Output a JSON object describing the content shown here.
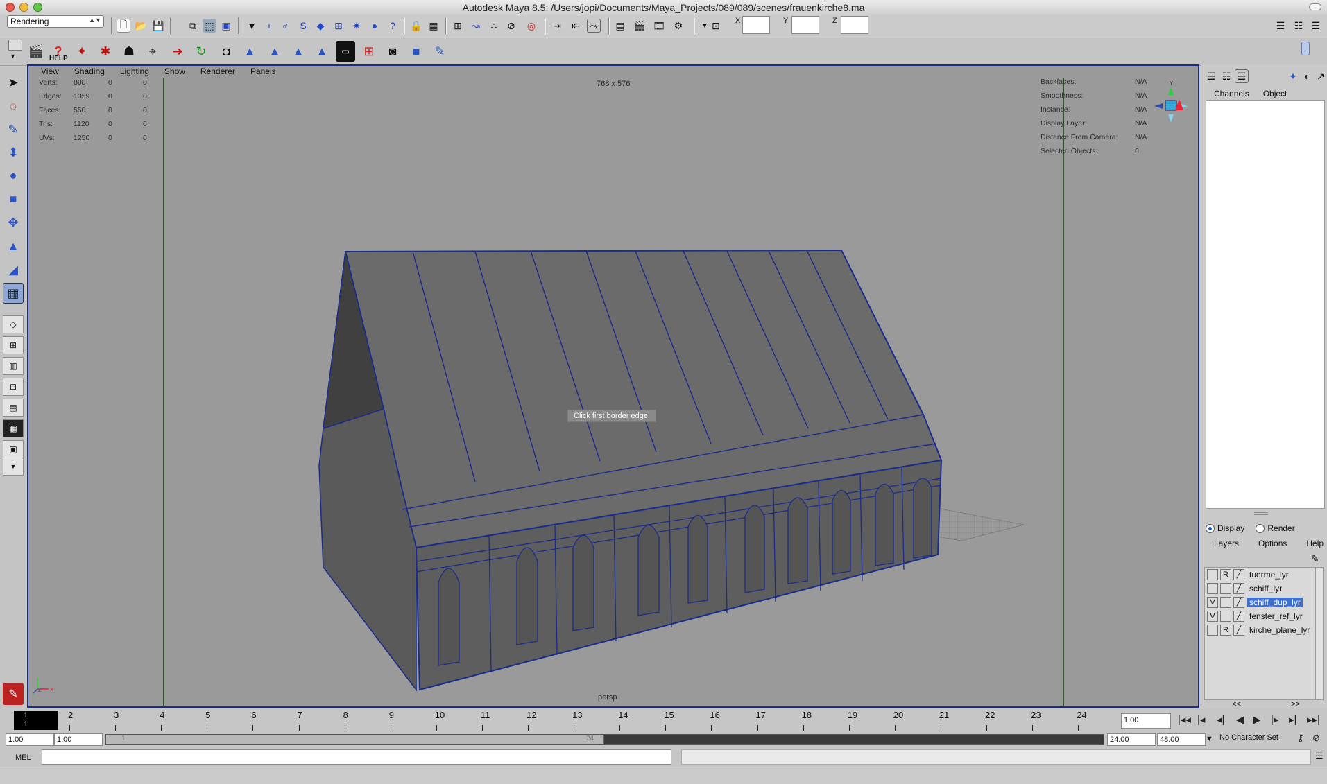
{
  "window": {
    "title": "Autodesk Maya 8.5: /Users/jopi/Documents/Maya_Projects/089/089/scenes/frauenkirche8.ma"
  },
  "status_line": {
    "menu_set": "Rendering",
    "x_label": "X",
    "y_label": "Y",
    "z_label": "Z",
    "x_value": "",
    "y_value": "",
    "z_value": ""
  },
  "shelf": {
    "help_label": "HELP"
  },
  "viewport": {
    "menus": [
      "View",
      "Shading",
      "Lighting",
      "Show",
      "Renderer",
      "Panels"
    ],
    "resolution": "768 x 576",
    "camera": "persp",
    "message": "Click first border edge.",
    "axis_y": "Y",
    "axis_z": "Z",
    "axis_x": "X",
    "hud_left_labels": [
      "Verts:",
      "Edges:",
      "Faces:",
      "Tris:",
      "UVs:"
    ],
    "hud_left_values": [
      "808",
      "1359",
      "550",
      "1120",
      "1250"
    ],
    "hud_left_zero1": [
      "0",
      "0",
      "0",
      "0",
      "0"
    ],
    "hud_left_zero2": [
      "0",
      "0",
      "0",
      "0",
      "0"
    ],
    "hud_right_labels": [
      "Backfaces:",
      "Smoothness:",
      "Instance:",
      "Display Layer:",
      "Distance From Camera:",
      "Selected Objects:"
    ],
    "hud_right_values": [
      "N/A",
      "N/A",
      "N/A",
      "N/A",
      "N/A",
      "0"
    ]
  },
  "channel_box": {
    "tab_channels": "Channels",
    "tab_object": "Object"
  },
  "layer_editor": {
    "radio_display": "Display",
    "radio_render": "Render",
    "menus": [
      "Layers",
      "Options",
      "Help"
    ],
    "layers": [
      {
        "name": "tuerme_lyr",
        "visible": "",
        "type": "R",
        "selected": false
      },
      {
        "name": "schiff_lyr",
        "visible": "",
        "type": "",
        "selected": false
      },
      {
        "name": "schiff_dup_lyr",
        "visible": "V",
        "type": "",
        "selected": true
      },
      {
        "name": "fenster_ref_lyr",
        "visible": "V",
        "type": "",
        "selected": false
      },
      {
        "name": "kirche_plane_lyr",
        "visible": "",
        "type": "R",
        "selected": false
      }
    ],
    "nav_left": "<<",
    "nav_right": ">>"
  },
  "time_slider": {
    "current_frame_top": "1",
    "current_frame_bottom": "1",
    "ticks": [
      "2",
      "3",
      "4",
      "5",
      "6",
      "7",
      "8",
      "9",
      "10",
      "11",
      "12",
      "13",
      "14",
      "15",
      "16",
      "17",
      "18",
      "19",
      "20",
      "21",
      "22",
      "23",
      "24"
    ],
    "current_time": "1.00"
  },
  "range_slider": {
    "start_time": "1.00",
    "playback_start": "1.00",
    "range_start_label": "1",
    "range_end_label": "24",
    "playback_end": "24.00",
    "end_time": "48.00",
    "character_set": "No Character Set"
  },
  "command_line": {
    "label": "MEL"
  },
  "colors": {
    "viewport_bg": "#9a9a9a",
    "wire": "#1a2c8a",
    "selection": "#3d6fd1"
  }
}
